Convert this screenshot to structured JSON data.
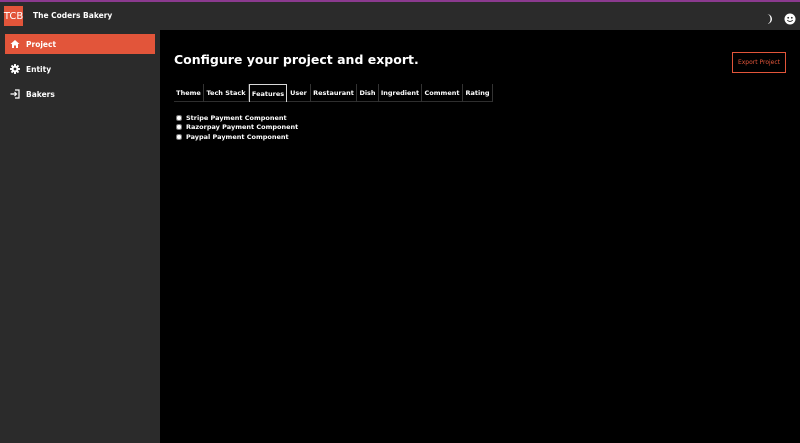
{
  "header": {
    "logo_text": "TCB",
    "app_title": "The Coders Bakery",
    "icons": [
      "moon-icon",
      "account-icon"
    ]
  },
  "sidebar": {
    "items": [
      {
        "label": "Project",
        "icon": "home-icon",
        "active": true
      },
      {
        "label": "Entity",
        "icon": "gear-icon",
        "active": false
      },
      {
        "label": "Bakers",
        "icon": "login-icon",
        "active": false
      }
    ]
  },
  "main": {
    "title": "Configure your project and export.",
    "export_label": "Export Project",
    "tabs": [
      {
        "label": "Theme"
      },
      {
        "label": "Tech Stack"
      },
      {
        "label": "Features"
      },
      {
        "label": "User"
      },
      {
        "label": "Restaurant"
      },
      {
        "label": "Dish"
      },
      {
        "label": "Ingredient"
      },
      {
        "label": "Comment"
      },
      {
        "label": "Rating"
      }
    ],
    "active_tab": "Features",
    "checkboxes": [
      {
        "label": "Stripe Payment Component",
        "checked": false
      },
      {
        "label": "Razorpay Payment Component",
        "checked": false
      },
      {
        "label": "Paypal Payment Component",
        "checked": false
      }
    ]
  },
  "colors": {
    "accent": "#e2553a",
    "sidebar_bg": "#2b2b2b",
    "main_bg": "#000000",
    "top_line": "#8b3a8f"
  }
}
